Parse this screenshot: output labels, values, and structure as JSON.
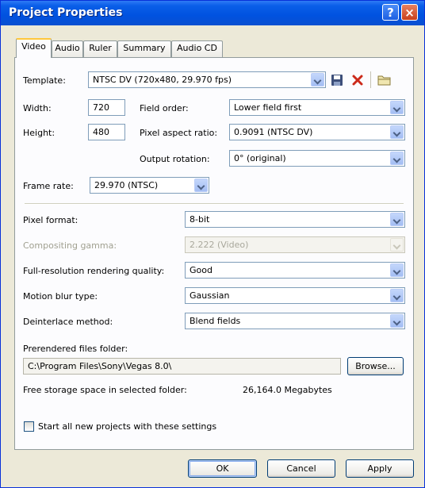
{
  "window": {
    "title": "Project Properties",
    "help_glyph": "?",
    "close_glyph": "×"
  },
  "tabs": [
    {
      "label": "Video",
      "active": true
    },
    {
      "label": "Audio",
      "active": false
    },
    {
      "label": "Ruler",
      "active": false
    },
    {
      "label": "Summary",
      "active": false
    },
    {
      "label": "Audio CD",
      "active": false
    }
  ],
  "template": {
    "label": "Template:",
    "value": "NTSC DV (720x480, 29.970 fps)"
  },
  "width": {
    "label": "Width:",
    "value": "720"
  },
  "height": {
    "label": "Height:",
    "value": "480"
  },
  "field_order": {
    "label": "Field order:",
    "value": "Lower field first"
  },
  "pixel_aspect": {
    "label": "Pixel aspect ratio:",
    "value": "0.9091 (NTSC DV)"
  },
  "output_rotation": {
    "label": "Output rotation:",
    "value": "0° (original)"
  },
  "frame_rate": {
    "label": "Frame rate:",
    "value": "29.970 (NTSC)"
  },
  "pixel_format": {
    "label": "Pixel format:",
    "value": "8-bit"
  },
  "compositing_gamma": {
    "label": "Compositing gamma:",
    "value": "2.222 (Video)",
    "enabled": false
  },
  "rendering_quality": {
    "label": "Full-resolution rendering quality:",
    "value": "Good"
  },
  "motion_blur": {
    "label": "Motion blur type:",
    "value": "Gaussian"
  },
  "deinterlace": {
    "label": "Deinterlace method:",
    "value": "Blend fields"
  },
  "prerender": {
    "label": "Prerendered files folder:",
    "path": "C:\\Program Files\\Sony\\Vegas 8.0\\",
    "browse_label": "Browse..."
  },
  "storage": {
    "label": "Free storage space in selected folder:",
    "value": "26,164.0 Megabytes"
  },
  "start_all": {
    "label": "Start all new projects with these settings",
    "checked": false
  },
  "buttons": {
    "ok": "OK",
    "cancel": "Cancel",
    "apply": "Apply"
  },
  "icons": {
    "save": "save-icon",
    "delete": "delete-icon",
    "folder": "folder-icon"
  },
  "colors": {
    "titlebar": "#0052e0",
    "tab_highlight": "#ffc73c",
    "delete_red": "#cc2a1a"
  }
}
